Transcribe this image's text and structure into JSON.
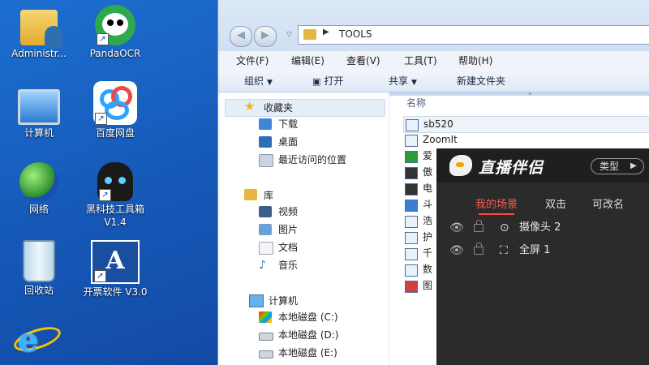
{
  "desktop": {
    "icons": [
      {
        "label": "Administr...",
        "icon": "user-folder-icon"
      },
      {
        "label": "PandaOCR",
        "icon": "panda-ocr-icon"
      },
      {
        "label": "计算机",
        "icon": "computer-icon"
      },
      {
        "label": "百度网盘",
        "icon": "baidu-netdisk-icon"
      },
      {
        "label": "网络",
        "icon": "network-globe-icon"
      },
      {
        "label": "黑科技工具箱 V1.4",
        "icon": "toolbox-cat-icon"
      },
      {
        "label": "回收站",
        "icon": "recycle-bin-icon"
      },
      {
        "label": "开票软件 V3.0",
        "icon": "invoice-software-icon"
      },
      {
        "label": "",
        "icon": "internet-explorer-icon"
      }
    ]
  },
  "explorer": {
    "address": "TOOLS",
    "menu": [
      "文件(F)",
      "编辑(E)",
      "查看(V)",
      "工具(T)",
      "帮助(H)"
    ],
    "commands": [
      "组织",
      "打开",
      "共享",
      "新建文件夹"
    ],
    "nav": {
      "favorites": "收藏夹",
      "fav_items": [
        "下载",
        "桌面",
        "最近访问的位置"
      ],
      "libraries": "库",
      "lib_items": [
        "视频",
        "图片",
        "文档",
        "音乐"
      ],
      "computer": "计算机",
      "drives": [
        "本地磁盘 (C:)",
        "本地磁盘 (D:)",
        "本地磁盘 (E:)"
      ]
    },
    "column_name": "名称",
    "files": [
      "sb520",
      "ZoomIt",
      "爱",
      "傲",
      "电",
      "斗",
      "浩",
      "护",
      "千",
      "数",
      "图"
    ]
  },
  "live": {
    "title": "直播伴侣",
    "type_button": "类型",
    "tabs": [
      "我的场景",
      "双击",
      "可改名"
    ],
    "scenes": [
      "摄像头 2",
      "全屏 1"
    ]
  },
  "colors": {
    "desktop_blue": "#1659b8",
    "live_bg": "#2b2b2b",
    "live_accent": "#ff5a4a"
  }
}
